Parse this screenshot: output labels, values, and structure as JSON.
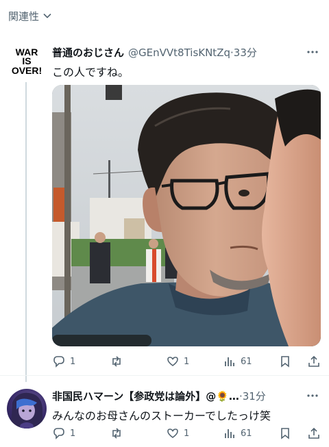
{
  "topbar": {
    "title": "関連性"
  },
  "tweets": [
    {
      "avatar_text": "WAR IS OVER!",
      "name": "普通のおじさん",
      "handle": "@GEnVVt8TisKNtZq",
      "dot": "·",
      "time": "33分",
      "text": "この人ですね。",
      "actions": {
        "reply": "1",
        "retweet": "",
        "like": "1",
        "views": "61"
      }
    },
    {
      "name": "非国民ハマーン【参政党は論外】@🌻…",
      "handle": "",
      "dot": "·",
      "time": "31分",
      "text": "みんなのお母さんのストーカーでしたっけ笑",
      "actions": {
        "reply": "1",
        "retweet": "",
        "like": "1",
        "views": "61"
      }
    }
  ],
  "colors": {
    "muted": "#536471",
    "text": "#0f1419",
    "thread_line": "#cfd9de"
  }
}
